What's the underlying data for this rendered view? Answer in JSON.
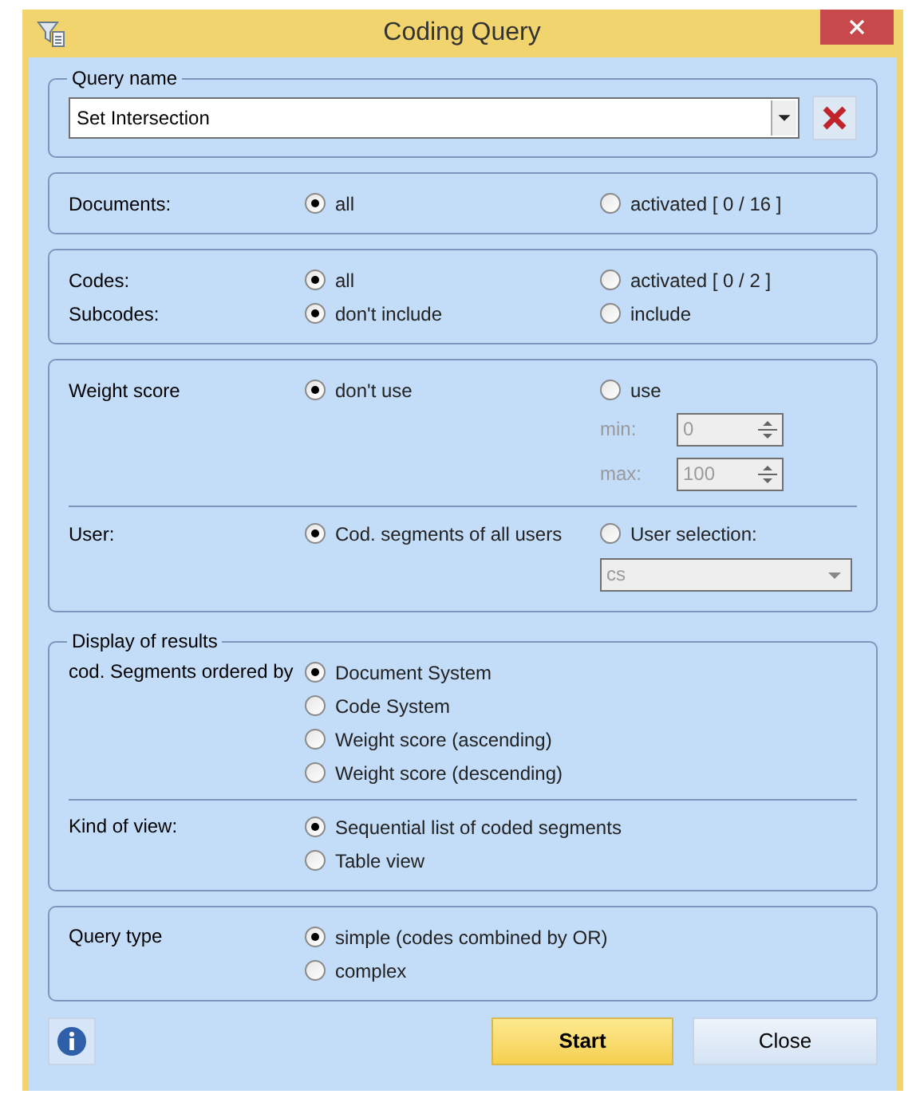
{
  "window": {
    "title": "Coding Query"
  },
  "query_name": {
    "legend": "Query name",
    "value": "Set Intersection"
  },
  "sections": [
    {
      "groups": [
        [
          {
            "kind": "radios",
            "label": "Documents:",
            "options": [
              {
                "label": "all",
                "selected": true
              },
              {
                "label": "activated [ 0 / 16 ]",
                "selected": false
              }
            ]
          }
        ]
      ]
    },
    {
      "groups": [
        [
          {
            "kind": "radios",
            "label": "Codes:",
            "options": [
              {
                "label": "all",
                "selected": true
              },
              {
                "label": "activated [ 0 / 2 ]",
                "selected": false
              }
            ]
          },
          {
            "kind": "radios",
            "label": "Subcodes:",
            "options": [
              {
                "label": "don't include",
                "selected": true
              },
              {
                "label": "include",
                "selected": false
              }
            ]
          }
        ]
      ]
    },
    {
      "groups": [
        [
          {
            "kind": "radios",
            "label": "Weight score",
            "options": [
              {
                "label": "don't use",
                "selected": true
              },
              {
                "label": "use",
                "selected": false
              }
            ]
          },
          {
            "kind": "spin",
            "label": "min:",
            "value": "0",
            "disabled": true
          },
          {
            "kind": "spin",
            "label": "max:",
            "value": "100",
            "disabled": true
          }
        ],
        [
          {
            "kind": "radios",
            "label": "User:",
            "options": [
              {
                "label": "Cod. segments of all users",
                "selected": true
              },
              {
                "label": "User selection:",
                "selected": false
              }
            ]
          },
          {
            "kind": "select",
            "value": "cs",
            "disabled": true
          }
        ]
      ]
    },
    {
      "legend": "Display of results",
      "groups": [
        [
          {
            "kind": "stack",
            "label": "cod. Segments ordered by",
            "options": [
              {
                "label": "Document System",
                "selected": true
              },
              {
                "label": "Code System",
                "selected": false
              },
              {
                "label": "Weight score (ascending)",
                "selected": false
              },
              {
                "label": "Weight score (descending)",
                "selected": false
              }
            ]
          }
        ],
        [
          {
            "kind": "stack",
            "label": "Kind of view:",
            "options": [
              {
                "label": "Sequential list of coded segments",
                "selected": true
              },
              {
                "label": "Table view",
                "selected": false
              }
            ]
          }
        ]
      ]
    },
    {
      "groups": [
        [
          {
            "kind": "stack",
            "label": "Query type",
            "options": [
              {
                "label": "simple (codes combined by OR)",
                "selected": true
              },
              {
                "label": "complex",
                "selected": false
              }
            ]
          }
        ]
      ]
    }
  ],
  "buttons": [
    {
      "label": "Start",
      "kind": "primary"
    },
    {
      "label": "Close",
      "kind": "default"
    }
  ]
}
